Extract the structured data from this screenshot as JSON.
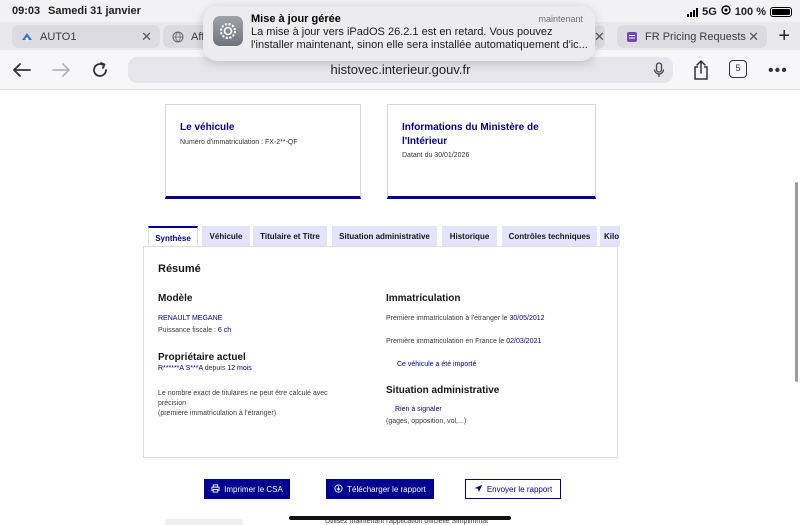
{
  "status": {
    "time": "09:03",
    "date": "Samedi 31 janvier",
    "network": "5G",
    "battery": "100 %"
  },
  "tabs": [
    {
      "label": "AUTO1",
      "icon": "auto1-icon"
    },
    {
      "label": "Affi",
      "icon": "globe-icon"
    },
    {
      "label": "FR Pricing Requests",
      "icon": "forms-icon"
    }
  ],
  "address": {
    "url": "histovec.interieur.gouv.fr",
    "tab_count": "5"
  },
  "notification": {
    "title": "Mise à jour gérée",
    "time": "maintenant",
    "body": "La mise à jour vers iPadOS 26.2.1 est en retard. Vous pouvez l'installer maintenant, sinon elle sera installée automatiquement d'ic..."
  },
  "cards": {
    "vehicle": {
      "title": "Le véhicule",
      "sub": "Numéro d'immatriculation : FX-2**-QF"
    },
    "ministry": {
      "title_line1": "Informations du Ministère de",
      "title_line2": "l'Intérieur",
      "sub": "Datant du 30/01/2026"
    }
  },
  "page_tabs": [
    "Synthèse",
    "Véhicule",
    "Titulaire et Titre",
    "Situation administrative",
    "Historique",
    "Contrôles techniques",
    "Kilo"
  ],
  "resume": {
    "title": "Résumé",
    "modele_title": "Modèle",
    "modele_name": "RENAULT MEGANE",
    "puissance_label": "Puissance fiscale : ",
    "puissance_value": "6 ch",
    "proprietaire_title": "Propriétaire actuel",
    "proprietaire_name": "R******A S***A",
    "proprietaire_depuis": " depuis ",
    "proprietaire_duree": "12 mois",
    "note_line1": "Le nombre exact de titulaires ne peut être calculé avec",
    "note_line2": "précision",
    "note_line3": "(première immatriculation à l'étranger)",
    "immat_title": "Immatriculation",
    "premiere_etranger_label": "Première immatriculation à l'étranger le ",
    "premiere_etranger_date": "30/05/2012",
    "premiere_france_label": "Première immatriculation en France le ",
    "premiere_france_date": "02/03/2021",
    "importe": "Ce véhicule a été importé",
    "situation_title": "Situation administrative",
    "rien": "Rien à signaler",
    "gages": "(gages, opposition, vol,...)"
  },
  "actions": {
    "imprimer": "Imprimer le CSA",
    "telecharger": "Télécharger le rapport",
    "envoyer": "Envoyer le rapport"
  },
  "footer": {
    "text": "Utilisez maintenant l'application officielle Simplimmat"
  },
  "colors": {
    "primary": "#000091",
    "tab_bg": "#e3e3fd"
  }
}
